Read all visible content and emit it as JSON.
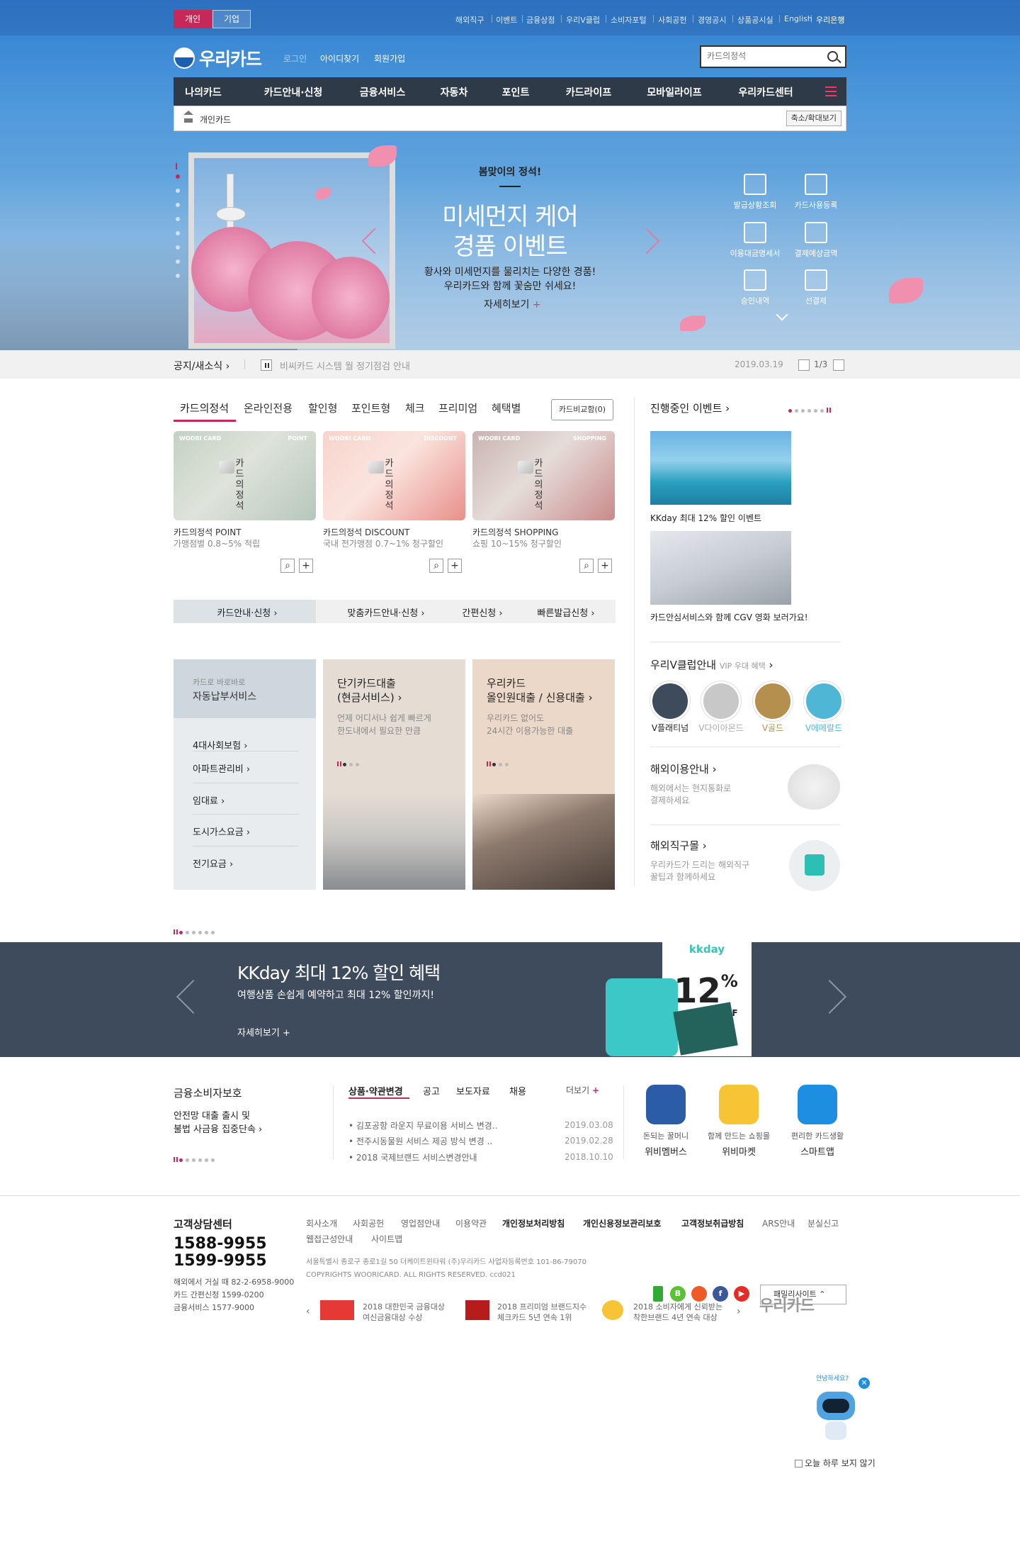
{
  "top": {
    "tabs": [
      "개인",
      "기업"
    ],
    "util_links": [
      "해외직구",
      "이벤트",
      "금융상점",
      "우리V클럽",
      "소비자포털",
      "사회공헌",
      "경영공시",
      "상품공시실",
      "English",
      "우리은행"
    ]
  },
  "header": {
    "logo": "우리카드",
    "links": [
      "로그인",
      "아이디찾기",
      "회원가입"
    ],
    "search_placeholder": "카드의정석"
  },
  "gnb": [
    "나의카드",
    "카드안내·신청",
    "금융서비스",
    "자동차",
    "포인트",
    "카드라이프",
    "모바일라이프",
    "우리카드센터"
  ],
  "breadcrumb": {
    "label": "개인카드",
    "zoom": "축소/확대보기"
  },
  "hero": {
    "sub": "봄맞이의 정석!",
    "title1": "미세먼지 케어",
    "title2": "경품 이벤트",
    "desc1": "황사와 미세먼지를 물리치는 다양한 경품!",
    "desc2": "우리카드와 함께 꽃숨만 쉬세요!",
    "more": "자세히보기",
    "quick": [
      "발급상황조회",
      "카드사용등록",
      "이용대금명세서",
      "결제예상금액",
      "승인내역",
      "선결제"
    ]
  },
  "notice": {
    "title": "공지/새소식",
    "message": "비씨카드 시스템 월 정기점검 안내",
    "date": "2019.03.19",
    "page": "1/3"
  },
  "card_tabs": [
    "카드의정석",
    "온라인전용",
    "할인형",
    "포인트형",
    "체크",
    "프리미엄",
    "혜택별"
  ],
  "compare": "카드비교함(0)",
  "cards": [
    {
      "tag": "WOORI CARD",
      "tag2": "POINT",
      "brand": "카드의정석",
      "name": "카드의정석 POINT",
      "desc": "가맹점별 0.8~5% 적립"
    },
    {
      "tag": "WOORI CARD",
      "tag2": "DISCOUNT",
      "brand": "카드의정석",
      "name": "카드의정석 DISCOUNT",
      "desc": "국내 전가맹점 0.7~1% 청구할인"
    },
    {
      "tag": "WOORI CARD",
      "tag2": "SHOPPING",
      "brand": "카드의정석",
      "name": "카드의정석 SHOPPING",
      "desc": "쇼핑 10~15% 청구할인"
    }
  ],
  "subnav": [
    "카드안내·신청",
    "맞춤카드안내·신청",
    "간편신청",
    "빠른발급신청"
  ],
  "autopay": {
    "small": "카드로 바로바로",
    "title": "자동납부서비스",
    "items": [
      "4대사회보험",
      "아파트관리비",
      "임대료",
      "도시가스요금",
      "전기요금"
    ]
  },
  "loans": [
    {
      "t1": "단기카드대출",
      "t2": "(현금서비스)",
      "d1": "언제 어디서나 쉽게 빠르게",
      "d2": "한도내에서 필요한 만큼"
    },
    {
      "t1": "우리카드",
      "t2": "올인원대출 / 신용대출",
      "d1": "우리카드 없어도",
      "d2": "24시간 이용가능한 대출"
    }
  ],
  "events": {
    "title": "진행중인 이벤트",
    "items": [
      "KKday 최대 12% 할인 이벤트",
      "카드안심서비스와 함께 CGV 영화 보러가요!"
    ]
  },
  "vclub": {
    "title": "우리V클럽안내",
    "sub": "VIP 우대 혜택",
    "grades": [
      "V플래티넘",
      "V다이아몬드",
      "V골드",
      "V에메랄드"
    ]
  },
  "overseas": {
    "title": "해외이용안내",
    "d1": "해외에서는 현지통화로",
    "d2": "결제하세요"
  },
  "direct": {
    "title": "해외직구몰",
    "d1": "우리카드가 드리는 해외직구",
    "d2": "꿀팁과 함께하세요"
  },
  "banner": {
    "title": "KKday 최대 12% 할인 혜택",
    "desc": "여행상품 손쉽게 예약하고 최대 12% 할인까지!",
    "more": "자세히보기",
    "brand": "kkday",
    "percent": "12",
    "pct_sign": "%",
    "off": "OFF"
  },
  "finance": {
    "title": "금융소비자보호",
    "d1": "안전망 대출 출시 및",
    "d2": "불법 사금융 집중단속"
  },
  "news_tabs": [
    "상품·약관변경",
    "공고",
    "보도자료",
    "채용"
  ],
  "news_more": "더보기",
  "news": [
    {
      "title": "김포공항 라운지 무료이용 서비스 변경..",
      "date": "2019.03.08"
    },
    {
      "title": "전주시동물원 서비스 제공 방식 변경 ..",
      "date": "2019.02.28"
    },
    {
      "title": "2018 국제브랜드 서비스변경안내",
      "date": "2018.10.10"
    }
  ],
  "apps": [
    {
      "a": "돈되는 꿀머니",
      "b": "위비멤버스"
    },
    {
      "a": "함께 만드는 쇼핑몰",
      "b": "위비마켓"
    },
    {
      "a": "편리한 카드생활",
      "b": "스마트앱"
    }
  ],
  "footer": {
    "cs_title": "고객상담센터",
    "phone1": "1588-9955",
    "phone2": "1599-9955",
    "abroad": "해외에서 거실 때 82-2-6958-9000",
    "card_apply": "카드 간편신청 1599-0200",
    "fin_service": "금융서비스 1577-9000",
    "links": [
      "회사소개",
      "사회공헌",
      "영업점안내",
      "이용약관",
      "개인정보처리방침",
      "개인신용정보관리보호",
      "고객정보취급방침",
      "ARS안내",
      "분실신고",
      "웹접근성안내",
      "사이트맵"
    ],
    "address": "서울특별시 종로구 종로1길 50 더케이트윈타워 (주)우리카드    사업자등록번호 101-86-79070",
    "copyright": "COPYRIGHTS WOORICARD. ALL RIGHTS RESERVED. ccd021",
    "family": "패밀리사이트",
    "awards": [
      {
        "l1": "2018 대한민국 금융대상",
        "l2": "여신금융대상 수상"
      },
      {
        "l1": "2018 프리미엄 브랜드지수",
        "l2": "체크카드 5년 연속 1위"
      },
      {
        "l1": "2018 소비자에게 신뢰받는",
        "l2": "착한브랜드 4년 연속 대상"
      }
    ],
    "logo": "우리카드"
  },
  "popup": {
    "bubble": "안녕하세요?",
    "check": "오늘 하루 보지 않기"
  }
}
